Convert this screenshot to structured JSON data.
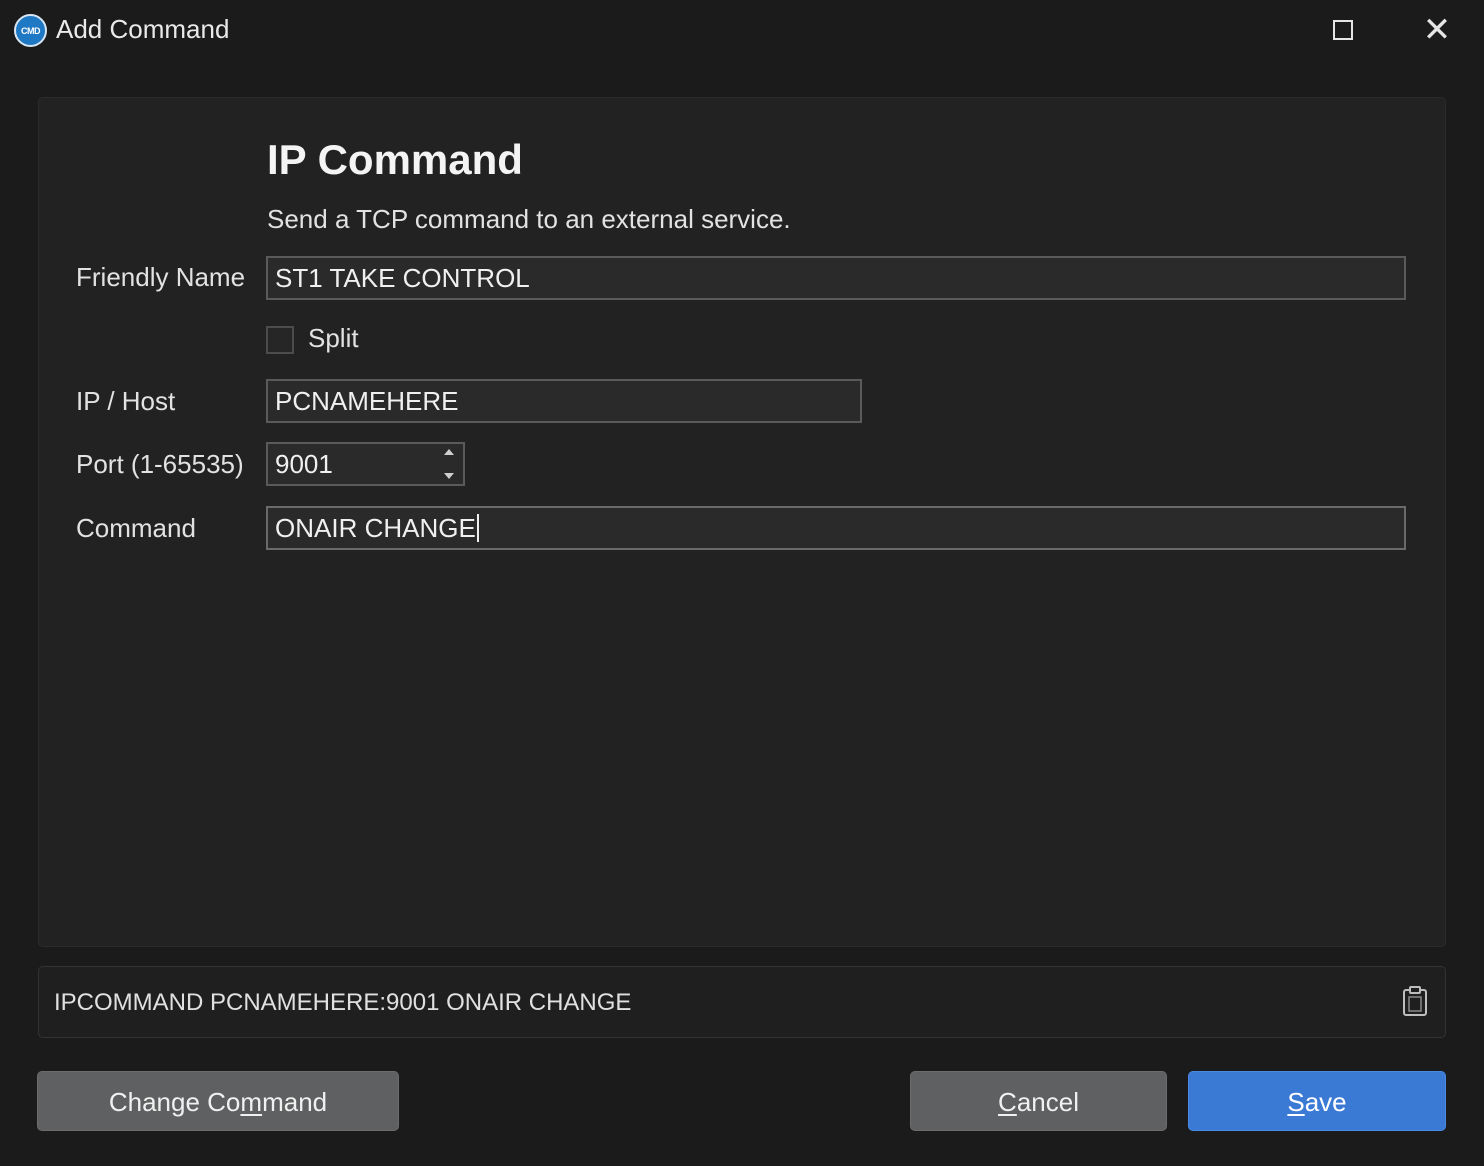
{
  "window": {
    "title": "Add Command",
    "app_icon_text": "CMD",
    "controls": [
      "maximize-icon",
      "close-icon"
    ]
  },
  "form": {
    "heading": "IP Command",
    "subtitle": "Send a TCP command to an external service.",
    "friendly_name": {
      "label": "Friendly Name",
      "value": "ST1 TAKE CONTROL"
    },
    "split": {
      "label": "Split",
      "checked": false
    },
    "ip_host": {
      "label": "IP / Host",
      "value": "PCNAMEHERE"
    },
    "port": {
      "label": "Port (1-65535)",
      "value": "9001"
    },
    "command": {
      "label": "Command",
      "value": "ONAIR CHANGE"
    }
  },
  "preview": {
    "text": "IPCOMMAND PCNAMEHERE:9001 ONAIR CHANGE",
    "copy_icon": "clipboard-icon"
  },
  "buttons": {
    "change_command": {
      "before": "Change Co",
      "accel": "m",
      "after": "mand"
    },
    "cancel": {
      "before": "",
      "accel": "C",
      "after": "ancel"
    },
    "save": {
      "before": "",
      "accel": "S",
      "after": "ave"
    }
  },
  "colors": {
    "background": "#1b1b1b",
    "panel": "#222222",
    "input_bg": "#2a2a2a",
    "input_border": "#5a5a5a",
    "button_gray": "#5f6061",
    "button_primary": "#3a79d4",
    "app_icon": "#1f78c4"
  }
}
